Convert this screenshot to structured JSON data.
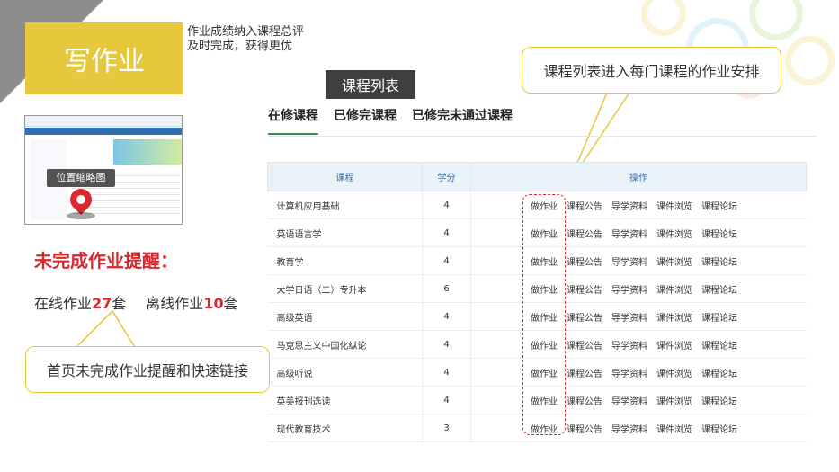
{
  "slide": {
    "title": "写作业",
    "subtitle_line1": "作业成绩纳入课程总评",
    "subtitle_line2": "及时完成，获得更优"
  },
  "thumbnail": {
    "label": "位置缩略图"
  },
  "reminder": {
    "title": "未完成作业提醒：",
    "online_prefix": "在线作业",
    "online_count": "27",
    "online_suffix": "套",
    "offline_prefix": "离线作业",
    "offline_count": "10",
    "offline_suffix": "套"
  },
  "callouts": {
    "home": "首页未完成作业提醒和快速链接",
    "course_list": "课程列表进入每门课程的作业安排"
  },
  "course_list_tag": "课程列表",
  "tabs": [
    {
      "label": "在修课程",
      "active": true
    },
    {
      "label": "已修完课程",
      "active": false
    },
    {
      "label": "已修完未通过课程",
      "active": false
    }
  ],
  "table": {
    "headers": {
      "course": "课程",
      "credit": "学分",
      "ops": "操作"
    },
    "actions": [
      "做作业",
      "课程公告",
      "导学资料",
      "课件浏览",
      "课程论坛"
    ],
    "rows": [
      {
        "course": "计算机应用基础",
        "credit": "4"
      },
      {
        "course": "英语语言学",
        "credit": "4"
      },
      {
        "course": "教育学",
        "credit": "4"
      },
      {
        "course": "大学日语（二）专升本",
        "credit": "6"
      },
      {
        "course": "高级英语",
        "credit": "4"
      },
      {
        "course": "马克思主义中国化纵论",
        "credit": "4"
      },
      {
        "course": "高级听说",
        "credit": "4"
      },
      {
        "course": "英美报刊选读",
        "credit": "4"
      },
      {
        "course": "现代教育技术",
        "credit": "3"
      }
    ]
  },
  "colors": {
    "accent_yellow": "#e7c83c",
    "highlight_red": "#d9282f",
    "table_header_bg": "#eaf1f7",
    "tab_underline": "#3f8a55"
  }
}
